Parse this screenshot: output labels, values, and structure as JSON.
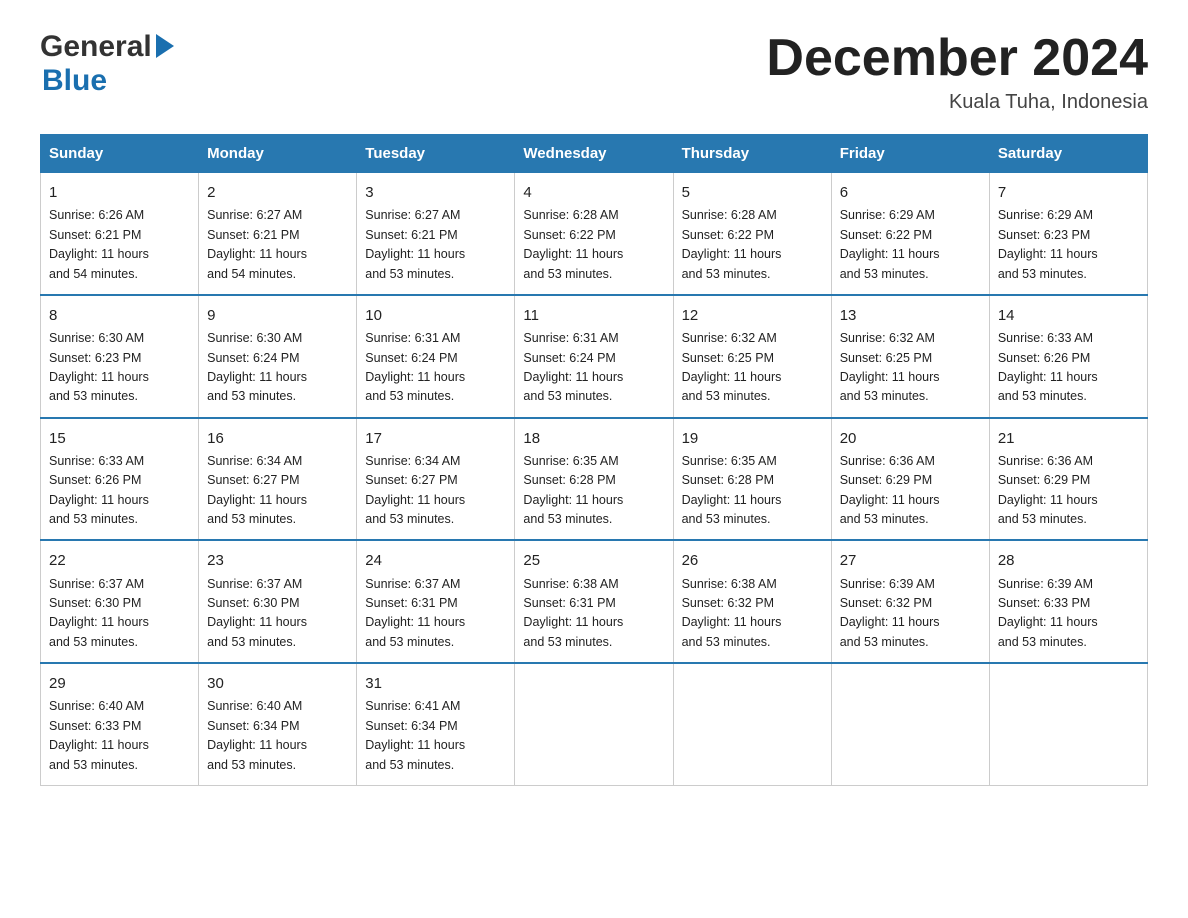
{
  "header": {
    "month_title": "December 2024",
    "location": "Kuala Tuha, Indonesia",
    "logo_general": "General",
    "logo_blue": "Blue"
  },
  "days_of_week": [
    "Sunday",
    "Monday",
    "Tuesday",
    "Wednesday",
    "Thursday",
    "Friday",
    "Saturday"
  ],
  "weeks": [
    [
      {
        "day": "1",
        "sunrise": "6:26 AM",
        "sunset": "6:21 PM",
        "daylight": "11 hours and 54 minutes."
      },
      {
        "day": "2",
        "sunrise": "6:27 AM",
        "sunset": "6:21 PM",
        "daylight": "11 hours and 54 minutes."
      },
      {
        "day": "3",
        "sunrise": "6:27 AM",
        "sunset": "6:21 PM",
        "daylight": "11 hours and 53 minutes."
      },
      {
        "day": "4",
        "sunrise": "6:28 AM",
        "sunset": "6:22 PM",
        "daylight": "11 hours and 53 minutes."
      },
      {
        "day": "5",
        "sunrise": "6:28 AM",
        "sunset": "6:22 PM",
        "daylight": "11 hours and 53 minutes."
      },
      {
        "day": "6",
        "sunrise": "6:29 AM",
        "sunset": "6:22 PM",
        "daylight": "11 hours and 53 minutes."
      },
      {
        "day": "7",
        "sunrise": "6:29 AM",
        "sunset": "6:23 PM",
        "daylight": "11 hours and 53 minutes."
      }
    ],
    [
      {
        "day": "8",
        "sunrise": "6:30 AM",
        "sunset": "6:23 PM",
        "daylight": "11 hours and 53 minutes."
      },
      {
        "day": "9",
        "sunrise": "6:30 AM",
        "sunset": "6:24 PM",
        "daylight": "11 hours and 53 minutes."
      },
      {
        "day": "10",
        "sunrise": "6:31 AM",
        "sunset": "6:24 PM",
        "daylight": "11 hours and 53 minutes."
      },
      {
        "day": "11",
        "sunrise": "6:31 AM",
        "sunset": "6:24 PM",
        "daylight": "11 hours and 53 minutes."
      },
      {
        "day": "12",
        "sunrise": "6:32 AM",
        "sunset": "6:25 PM",
        "daylight": "11 hours and 53 minutes."
      },
      {
        "day": "13",
        "sunrise": "6:32 AM",
        "sunset": "6:25 PM",
        "daylight": "11 hours and 53 minutes."
      },
      {
        "day": "14",
        "sunrise": "6:33 AM",
        "sunset": "6:26 PM",
        "daylight": "11 hours and 53 minutes."
      }
    ],
    [
      {
        "day": "15",
        "sunrise": "6:33 AM",
        "sunset": "6:26 PM",
        "daylight": "11 hours and 53 minutes."
      },
      {
        "day": "16",
        "sunrise": "6:34 AM",
        "sunset": "6:27 PM",
        "daylight": "11 hours and 53 minutes."
      },
      {
        "day": "17",
        "sunrise": "6:34 AM",
        "sunset": "6:27 PM",
        "daylight": "11 hours and 53 minutes."
      },
      {
        "day": "18",
        "sunrise": "6:35 AM",
        "sunset": "6:28 PM",
        "daylight": "11 hours and 53 minutes."
      },
      {
        "day": "19",
        "sunrise": "6:35 AM",
        "sunset": "6:28 PM",
        "daylight": "11 hours and 53 minutes."
      },
      {
        "day": "20",
        "sunrise": "6:36 AM",
        "sunset": "6:29 PM",
        "daylight": "11 hours and 53 minutes."
      },
      {
        "day": "21",
        "sunrise": "6:36 AM",
        "sunset": "6:29 PM",
        "daylight": "11 hours and 53 minutes."
      }
    ],
    [
      {
        "day": "22",
        "sunrise": "6:37 AM",
        "sunset": "6:30 PM",
        "daylight": "11 hours and 53 minutes."
      },
      {
        "day": "23",
        "sunrise": "6:37 AM",
        "sunset": "6:30 PM",
        "daylight": "11 hours and 53 minutes."
      },
      {
        "day": "24",
        "sunrise": "6:37 AM",
        "sunset": "6:31 PM",
        "daylight": "11 hours and 53 minutes."
      },
      {
        "day": "25",
        "sunrise": "6:38 AM",
        "sunset": "6:31 PM",
        "daylight": "11 hours and 53 minutes."
      },
      {
        "day": "26",
        "sunrise": "6:38 AM",
        "sunset": "6:32 PM",
        "daylight": "11 hours and 53 minutes."
      },
      {
        "day": "27",
        "sunrise": "6:39 AM",
        "sunset": "6:32 PM",
        "daylight": "11 hours and 53 minutes."
      },
      {
        "day": "28",
        "sunrise": "6:39 AM",
        "sunset": "6:33 PM",
        "daylight": "11 hours and 53 minutes."
      }
    ],
    [
      {
        "day": "29",
        "sunrise": "6:40 AM",
        "sunset": "6:33 PM",
        "daylight": "11 hours and 53 minutes."
      },
      {
        "day": "30",
        "sunrise": "6:40 AM",
        "sunset": "6:34 PM",
        "daylight": "11 hours and 53 minutes."
      },
      {
        "day": "31",
        "sunrise": "6:41 AM",
        "sunset": "6:34 PM",
        "daylight": "11 hours and 53 minutes."
      },
      null,
      null,
      null,
      null
    ]
  ],
  "labels": {
    "sunrise": "Sunrise:",
    "sunset": "Sunset:",
    "daylight": "Daylight:"
  }
}
